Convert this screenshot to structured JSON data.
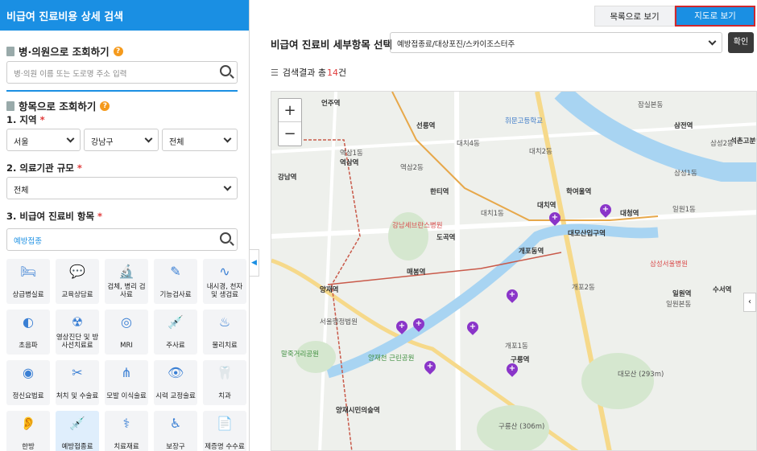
{
  "sidebar": {
    "header": "비급여 진료비용 상세 검색",
    "hospital_search": {
      "title": "병·의원으로 조회하기",
      "placeholder": "병·의원 이름 또는 도로명 주소 입력"
    },
    "item_search": {
      "title": "항목으로 조회하기",
      "region_label": "1. 지역",
      "region_values": [
        "서울",
        "강남구",
        "전체"
      ],
      "scale_label": "2. 의료기관 규모",
      "scale_value": "전체",
      "category_label": "3. 비급여 진료비 항목",
      "category_value": "예방접종",
      "required_mark": "*"
    },
    "categories": [
      {
        "label": "상급병실료",
        "icon": "bed-icon"
      },
      {
        "label": "교육상담료",
        "icon": "consult-icon"
      },
      {
        "label": "검체, 병리 검사료",
        "icon": "microscope-icon"
      },
      {
        "label": "기능검사료",
        "icon": "pen-test-icon"
      },
      {
        "label": "내시경, 천자 및 생검료",
        "icon": "endoscope-icon"
      },
      {
        "label": "초음파",
        "icon": "ultrasound-icon"
      },
      {
        "label": "영상진단 및 방사선치료료",
        "icon": "xray-icon"
      },
      {
        "label": "MRI",
        "icon": "mri-icon"
      },
      {
        "label": "주사료",
        "icon": "syringe-icon"
      },
      {
        "label": "물리치료",
        "icon": "physio-icon"
      },
      {
        "label": "정신요법료",
        "icon": "brain-icon"
      },
      {
        "label": "처치 및 수술료",
        "icon": "surgery-icon"
      },
      {
        "label": "모발 이식술료",
        "icon": "hair-icon"
      },
      {
        "label": "시력 교정술료",
        "icon": "eye-icon"
      },
      {
        "label": "치과",
        "icon": "tooth-icon"
      },
      {
        "label": "한방",
        "icon": "ear-icon"
      },
      {
        "label": "예방접종료",
        "icon": "vaccine-icon"
      },
      {
        "label": "치료재료",
        "icon": "implant-icon"
      },
      {
        "label": "보장구",
        "icon": "wheelchair-icon"
      },
      {
        "label": "제증명 수수료",
        "icon": "certificate-icon"
      }
    ],
    "selected_category_index": 16
  },
  "main": {
    "tabs": [
      {
        "label": "목록으로 보기",
        "active": false
      },
      {
        "label": "지도로 보기",
        "active": true
      }
    ],
    "detail_title": "비급여 진료비 세부항목 선택",
    "detail_value": "예방접종료/대상포진/스카이조스터주",
    "confirm_label": "확인",
    "result_prefix": "검색결과 총",
    "result_count": "14",
    "result_suffix": "건"
  },
  "map": {
    "zoom_in": "+",
    "zoom_out": "−",
    "labels": [
      "언주역",
      "선릉역",
      "대치4동",
      "역삼1동",
      "역삼역",
      "역삼2동",
      "강남역",
      "대치2동",
      "대치1동",
      "한티역",
      "대치역",
      "학여울역",
      "대모산입구역",
      "대청역",
      "일원1동",
      "개포동역",
      "도곡역",
      "매봉역",
      "양재역",
      "개포2동",
      "개포1동",
      "구룡역",
      "일원역",
      "일원본동",
      "수서역",
      "양재시민의숲역",
      "대모산 (293m)",
      "구룡산 (306m)",
      "삼성1동",
      "삼성2동",
      "잠실본동",
      "삼전역",
      "석촌고분역",
      "휘문고등학교",
      "강남세브란스병원",
      "서울행정법원",
      "양재천 근린공원",
      "말죽거리공원",
      "삼성서울병원"
    ],
    "pins": 8
  },
  "colors": {
    "accent": "#1a8fe3",
    "required": "#e03a3a",
    "pin": "#8a35c9",
    "tab_border": "#d0282e"
  }
}
